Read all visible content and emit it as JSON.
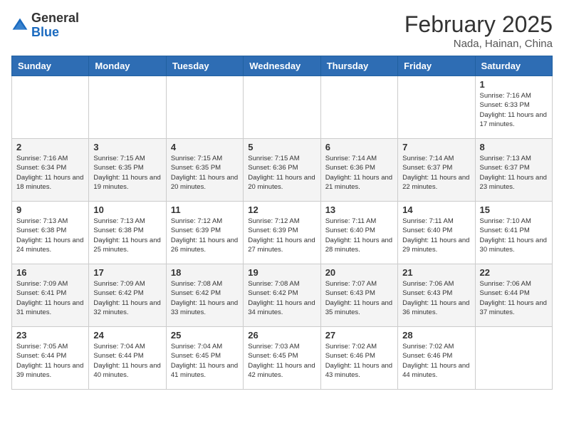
{
  "header": {
    "logo_general": "General",
    "logo_blue": "Blue",
    "month_title": "February 2025",
    "location": "Nada, Hainan, China"
  },
  "days_of_week": [
    "Sunday",
    "Monday",
    "Tuesday",
    "Wednesday",
    "Thursday",
    "Friday",
    "Saturday"
  ],
  "weeks": [
    [
      {
        "day": "",
        "info": ""
      },
      {
        "day": "",
        "info": ""
      },
      {
        "day": "",
        "info": ""
      },
      {
        "day": "",
        "info": ""
      },
      {
        "day": "",
        "info": ""
      },
      {
        "day": "",
        "info": ""
      },
      {
        "day": "1",
        "info": "Sunrise: 7:16 AM\nSunset: 6:33 PM\nDaylight: 11 hours and 17 minutes."
      }
    ],
    [
      {
        "day": "2",
        "info": "Sunrise: 7:16 AM\nSunset: 6:34 PM\nDaylight: 11 hours and 18 minutes."
      },
      {
        "day": "3",
        "info": "Sunrise: 7:15 AM\nSunset: 6:35 PM\nDaylight: 11 hours and 19 minutes."
      },
      {
        "day": "4",
        "info": "Sunrise: 7:15 AM\nSunset: 6:35 PM\nDaylight: 11 hours and 20 minutes."
      },
      {
        "day": "5",
        "info": "Sunrise: 7:15 AM\nSunset: 6:36 PM\nDaylight: 11 hours and 20 minutes."
      },
      {
        "day": "6",
        "info": "Sunrise: 7:14 AM\nSunset: 6:36 PM\nDaylight: 11 hours and 21 minutes."
      },
      {
        "day": "7",
        "info": "Sunrise: 7:14 AM\nSunset: 6:37 PM\nDaylight: 11 hours and 22 minutes."
      },
      {
        "day": "8",
        "info": "Sunrise: 7:13 AM\nSunset: 6:37 PM\nDaylight: 11 hours and 23 minutes."
      }
    ],
    [
      {
        "day": "9",
        "info": "Sunrise: 7:13 AM\nSunset: 6:38 PM\nDaylight: 11 hours and 24 minutes."
      },
      {
        "day": "10",
        "info": "Sunrise: 7:13 AM\nSunset: 6:38 PM\nDaylight: 11 hours and 25 minutes."
      },
      {
        "day": "11",
        "info": "Sunrise: 7:12 AM\nSunset: 6:39 PM\nDaylight: 11 hours and 26 minutes."
      },
      {
        "day": "12",
        "info": "Sunrise: 7:12 AM\nSunset: 6:39 PM\nDaylight: 11 hours and 27 minutes."
      },
      {
        "day": "13",
        "info": "Sunrise: 7:11 AM\nSunset: 6:40 PM\nDaylight: 11 hours and 28 minutes."
      },
      {
        "day": "14",
        "info": "Sunrise: 7:11 AM\nSunset: 6:40 PM\nDaylight: 11 hours and 29 minutes."
      },
      {
        "day": "15",
        "info": "Sunrise: 7:10 AM\nSunset: 6:41 PM\nDaylight: 11 hours and 30 minutes."
      }
    ],
    [
      {
        "day": "16",
        "info": "Sunrise: 7:09 AM\nSunset: 6:41 PM\nDaylight: 11 hours and 31 minutes."
      },
      {
        "day": "17",
        "info": "Sunrise: 7:09 AM\nSunset: 6:42 PM\nDaylight: 11 hours and 32 minutes."
      },
      {
        "day": "18",
        "info": "Sunrise: 7:08 AM\nSunset: 6:42 PM\nDaylight: 11 hours and 33 minutes."
      },
      {
        "day": "19",
        "info": "Sunrise: 7:08 AM\nSunset: 6:42 PM\nDaylight: 11 hours and 34 minutes."
      },
      {
        "day": "20",
        "info": "Sunrise: 7:07 AM\nSunset: 6:43 PM\nDaylight: 11 hours and 35 minutes."
      },
      {
        "day": "21",
        "info": "Sunrise: 7:06 AM\nSunset: 6:43 PM\nDaylight: 11 hours and 36 minutes."
      },
      {
        "day": "22",
        "info": "Sunrise: 7:06 AM\nSunset: 6:44 PM\nDaylight: 11 hours and 37 minutes."
      }
    ],
    [
      {
        "day": "23",
        "info": "Sunrise: 7:05 AM\nSunset: 6:44 PM\nDaylight: 11 hours and 39 minutes."
      },
      {
        "day": "24",
        "info": "Sunrise: 7:04 AM\nSunset: 6:44 PM\nDaylight: 11 hours and 40 minutes."
      },
      {
        "day": "25",
        "info": "Sunrise: 7:04 AM\nSunset: 6:45 PM\nDaylight: 11 hours and 41 minutes."
      },
      {
        "day": "26",
        "info": "Sunrise: 7:03 AM\nSunset: 6:45 PM\nDaylight: 11 hours and 42 minutes."
      },
      {
        "day": "27",
        "info": "Sunrise: 7:02 AM\nSunset: 6:46 PM\nDaylight: 11 hours and 43 minutes."
      },
      {
        "day": "28",
        "info": "Sunrise: 7:02 AM\nSunset: 6:46 PM\nDaylight: 11 hours and 44 minutes."
      },
      {
        "day": "",
        "info": ""
      }
    ]
  ]
}
